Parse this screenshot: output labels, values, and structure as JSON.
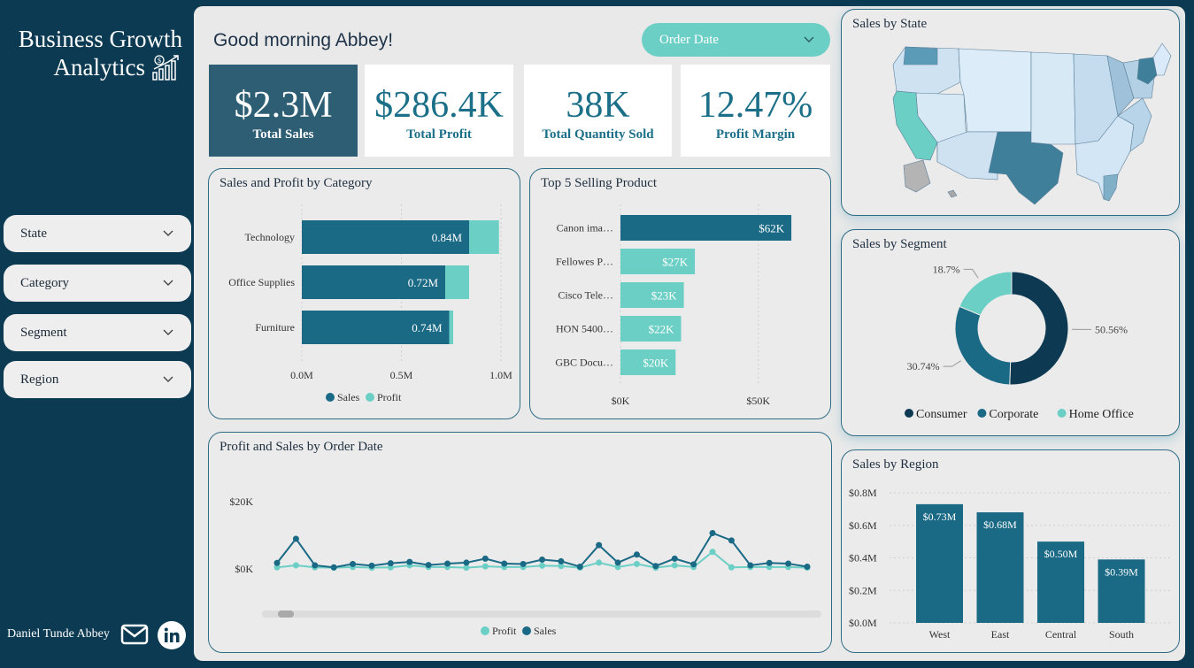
{
  "brand": {
    "line1": "Business Growth",
    "line2": "Analytics"
  },
  "filters": [
    {
      "label": "State"
    },
    {
      "label": "Category"
    },
    {
      "label": "Segment"
    },
    {
      "label": "Region"
    }
  ],
  "footer": {
    "author": "Daniel Tunde Abbey"
  },
  "header": {
    "greeting": "Good morning Abbey!",
    "order_date_label": "Order Date"
  },
  "kpis": [
    {
      "value": "$2.3M",
      "label": "Total Sales"
    },
    {
      "value": "$286.4K",
      "label": "Total Profit"
    },
    {
      "value": "38K",
      "label": "Total Quantity Sold"
    },
    {
      "value": "12.47%",
      "label": "Profit Margin"
    }
  ],
  "titles": {
    "category": "Sales and Profit by Category",
    "top5": "Top 5 Selling Product",
    "timeline": "Profit and Sales by Order Date",
    "state": "Sales by State",
    "segment": "Sales by Segment",
    "region": "Sales by Region"
  },
  "colors": {
    "sales": "#1a6985",
    "profit": "#6ccfc5",
    "dark": "#0d3a52"
  },
  "chart_data": [
    {
      "type": "bar",
      "orientation": "horizontal-stacked",
      "title": "Sales and Profit by Category",
      "categories": [
        "Technology",
        "Office Supplies",
        "Furniture"
      ],
      "series": [
        {
          "name": "Sales",
          "values": [
            0.84,
            0.72,
            0.74
          ],
          "labels": [
            "0.84M",
            "0.72M",
            "0.74M"
          ]
        },
        {
          "name": "Profit",
          "values": [
            0.15,
            0.12,
            0.02
          ]
        }
      ],
      "xticks": [
        "0.0M",
        "0.5M",
        "1.0M"
      ],
      "xlim": [
        0,
        1.0
      ],
      "legend": "bottom"
    },
    {
      "type": "bar",
      "orientation": "horizontal",
      "title": "Top 5 Selling Product",
      "categories": [
        "Canon ima…",
        "Fellowes P…",
        "Cisco Tele…",
        "HON 5400…",
        "GBC Docu…"
      ],
      "values": [
        62,
        27,
        23,
        22,
        20
      ],
      "labels": [
        "$62K",
        "$27K",
        "$23K",
        "$22K",
        "$20K"
      ],
      "xticks": [
        "$0K",
        "$50K"
      ],
      "xlim": [
        0,
        70
      ]
    },
    {
      "type": "line",
      "title": "Profit and Sales by Order Date",
      "yticks": [
        "$20K",
        "$0K"
      ],
      "ylim": [
        0,
        20
      ],
      "series": [
        {
          "name": "Sales",
          "values": [
            1.5,
            8.7,
            0.8,
            0.2,
            1.2,
            0.7,
            1.4,
            1.8,
            0.9,
            1.3,
            1.6,
            2.8,
            1.3,
            1.2,
            2.5,
            2.0,
            0.4,
            6.8,
            1.6,
            4.0,
            0.6,
            2.8,
            1.1,
            10.4,
            8.2,
            0.8,
            1.5,
            1.3,
            0.4
          ]
        },
        {
          "name": "Profit",
          "values": [
            0.2,
            0.8,
            0.2,
            0.1,
            0.3,
            0.1,
            0.2,
            0.8,
            0.3,
            0.3,
            0.1,
            0.5,
            0.3,
            0.3,
            0.7,
            0.6,
            0.1,
            1.6,
            0.3,
            1.2,
            0.1,
            0.8,
            0.3,
            4.8,
            0.2,
            0.3,
            0.3,
            0.3,
            0.1
          ]
        }
      ],
      "legend": "bottom"
    },
    {
      "type": "pie",
      "subtype": "donut",
      "title": "Sales by Segment",
      "categories": [
        "Consumer",
        "Corporate",
        "Home Office"
      ],
      "values": [
        50.56,
        30.74,
        18.7
      ],
      "labels": [
        "50.56%",
        "30.74%",
        "18.7%"
      ],
      "legend": "bottom"
    },
    {
      "type": "bar",
      "title": "Sales by Region",
      "categories": [
        "West",
        "East",
        "Central",
        "South"
      ],
      "values": [
        0.73,
        0.68,
        0.5,
        0.39
      ],
      "labels": [
        "$0.73M",
        "$0.68M",
        "$0.50M",
        "$0.39M"
      ],
      "yticks": [
        "$0.8M",
        "$0.6M",
        "$0.4M",
        "$0.2M",
        "$0.0M"
      ],
      "ylim": [
        0,
        0.8
      ]
    }
  ]
}
